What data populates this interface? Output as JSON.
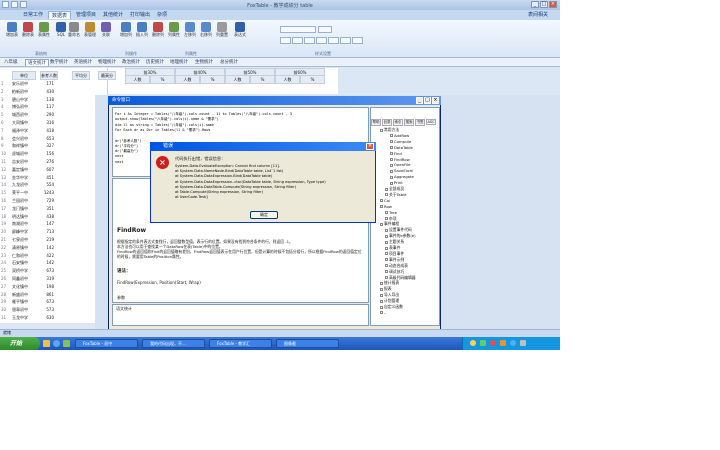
{
  "app": {
    "title": "FoxTable - 教学成绩分 table"
  },
  "menus": [
    "日常工作",
    "数据表",
    "管理项目",
    "其他统计",
    "打印输出",
    "杂项"
  ],
  "menu_right": "表间相关",
  "ribbon": {
    "buttons": [
      {
        "label": "增加表",
        "color": "#4b7fc4"
      },
      {
        "label": "删除表",
        "color": "#c04848"
      },
      {
        "label": "表属性",
        "color": "#6a9a4a"
      },
      {
        "label": "SQL",
        "color": "#3060a8"
      },
      {
        "label": "重命名",
        "color": "#8a8a8a"
      },
      {
        "label": "表管理",
        "color": "#c08a30"
      },
      {
        "label": "关联",
        "color": "#7060b0"
      },
      {
        "label": "增加列",
        "color": "#4b7fc4"
      },
      {
        "label": "插入列",
        "color": "#4b7fc4"
      },
      {
        "label": "删除列",
        "color": "#c04848"
      },
      {
        "label": "列属性",
        "color": "#6a9a4a"
      },
      {
        "label": "左移列",
        "color": "#5a8acb"
      },
      {
        "label": "右移列",
        "color": "#5a8acb"
      },
      {
        "label": "列重置",
        "color": "#9a9a9a"
      },
      {
        "label": "表达式",
        "color": "#3060a8"
      }
    ],
    "groups": [
      "表结构",
      "列操作",
      "列属性",
      "样式设置"
    ]
  },
  "tabs": [
    "八年级",
    "语文统计",
    "数学统计",
    "英语统计",
    "物理统计",
    "政治统计",
    "历史统计",
    "地理统计",
    "生物统计",
    "总分统计"
  ],
  "active_tab": "语文统计",
  "grid": {
    "headers": [
      "单位",
      "参考人数",
      "平均分",
      "最高分",
      "前30%",
      "前40%",
      "前50%",
      "前60%"
    ],
    "subheaders": [
      "人数",
      "%",
      "人数",
      "%",
      "人数",
      "%",
      "人数",
      "%"
    ],
    "rows": [
      [
        "安乐初中",
        "171"
      ],
      [
        "柏新初中",
        "430"
      ],
      [
        "碧山中学",
        "138"
      ],
      [
        "博弘初中",
        "117"
      ],
      [
        "城西初中",
        "290"
      ],
      [
        "大同镇中",
        "316"
      ],
      [
        "福泽中学",
        "418"
      ],
      [
        "会兴初中",
        "653"
      ],
      [
        "和祥镇中",
        "327"
      ],
      [
        "虎城初中",
        "156"
      ],
      [
        "吉安初中",
        "276"
      ],
      [
        "嘉定镇中",
        "607"
      ],
      [
        "金华中学",
        "451"
      ],
      [
        "九龙初中",
        "554"
      ],
      [
        "莱平一中",
        "1243"
      ],
      [
        "兰园初中",
        "729"
      ],
      [
        "龙门镇中",
        "351"
      ],
      [
        "明达镇中",
        "438"
      ],
      [
        "南湖初中",
        "147"
      ],
      [
        "屏峰中学",
        "713"
      ],
      [
        "七泉初中",
        "219"
      ],
      [
        "清原镇中",
        "142"
      ],
      [
        "仁和初中",
        "422"
      ],
      [
        "石安镇中",
        "142"
      ],
      [
        "双桥中学",
        "673"
      ],
      [
        "同鑫初中",
        "319"
      ],
      [
        "文化镇中",
        "198"
      ],
      [
        "新盛初中",
        "861"
      ],
      [
        "雁平镇中",
        "673"
      ],
      [
        "银翠初中",
        "573"
      ],
      [
        "玉龙中学",
        "630"
      ]
    ]
  },
  "command_window": {
    "title": "命令窗口",
    "code_lines": [
      "For i As Integer = Tables(\"八年级\").cols.count - 11 to Tables(\"八年级\").cols.count - 3",
      "output.show(Tables(\"八年级\").cols(i).name & \"需求\")",
      "dim ll as string = Tables(\"八年级\").cols(i).name",
      "For Each dr as Dcr in Tables(ll & \"需求\").Rows",
      "",
      "dr(\"参考人数\")",
      "dr(\"平均分\")",
      "dr(\"最高分\")",
      "next",
      "next"
    ],
    "help": {
      "heading": "FindRow",
      "paragraph1": "根据指定的条件表达式查找行，返回整数型值，表示行的位置。如果没有找到符合条件的行，则返回 -1。",
      "paragraph2": "本方法也可以用于查找某一个DataRow在表(Table)中的位置。",
      "paragraph3": "FindRow的返回值和Find的返回值略有差别，FindRow返回值表示在用户行位置，但是计算的时候不包括分组行，所以根据FindRow的返回值定位的时候，需要用Table的Position属性。",
      "syntax_label": "语法：",
      "syntax": "FindRow(Expression, Position(Start, Wrap)",
      "param_label": "参数",
      "footer_label": "语文统计"
    },
    "buttons": [
      "查找替换",
      "执行",
      "取消"
    ]
  },
  "tree": {
    "tabs": [
      "帮助",
      "目录",
      "索引",
      "搜索",
      "书签",
      "ASC"
    ],
    "nodes": [
      {
        "label": "常用方法",
        "indent": 0
      },
      {
        "label": "AddRow",
        "indent": 2
      },
      {
        "label": "Compute",
        "indent": 2
      },
      {
        "label": "DataTable",
        "indent": 2
      },
      {
        "label": "Find",
        "indent": 2
      },
      {
        "label": "FindRow",
        "indent": 2
      },
      {
        "label": "OpenFile",
        "indent": 2
      },
      {
        "label": "SaveExcel",
        "indent": 2
      },
      {
        "label": "Aggregate",
        "indent": 2
      },
      {
        "label": "Print",
        "indent": 2
      },
      {
        "label": "全部成员",
        "indent": 1
      },
      {
        "label": "关于Table",
        "indent": 1
      },
      {
        "label": "Col",
        "indent": 0
      },
      {
        "label": "Row",
        "indent": 0
      },
      {
        "label": "Tree",
        "indent": 1
      },
      {
        "label": "杂项",
        "indent": 1
      },
      {
        "label": "事件编程",
        "indent": 0
      },
      {
        "label": "设置事件代码",
        "indent": 1
      },
      {
        "label": "事件的e参数(e)",
        "indent": 1
      },
      {
        "label": "主题关系",
        "indent": 1
      },
      {
        "label": "表事件",
        "indent": 1
      },
      {
        "label": "项目事件",
        "indent": 1
      },
      {
        "label": "事件示例",
        "indent": 1
      },
      {
        "label": "动态合成表",
        "indent": 1
      },
      {
        "label": "调试技巧",
        "indent": 1
      },
      {
        "label": "高级代码编辑器",
        "indent": 1
      },
      {
        "label": "统计报表",
        "indent": 0
      },
      {
        "label": "报表",
        "indent": 0
      },
      {
        "label": "导入导出",
        "indent": 0
      },
      {
        "label": "计划管理",
        "indent": 0
      },
      {
        "label": "自定义函数",
        "indent": 0
      },
      {
        "label": "..",
        "indent": 0
      }
    ]
  },
  "error_dialog": {
    "title": "错误",
    "message_title": "代码执行出错，错误信息：",
    "lines": [
      "System.Data.EvaluateException: Cannot find column [11].",
      "   at System.Data.NameNode.Bind(DataTable table, List`1 list)",
      "   at System.Data.DataExpression.Bind(DataTable table)",
      "   at System.Data.DataExpression..ctor(DataTable table, String expression, Type type)",
      "   at System.Data.DataTable.Compute(String expression, String filter)",
      "   at Table.Compute(String expression, String filter)",
      "   at UserCode.Test()"
    ],
    "ok": "确定"
  },
  "status_text": "就绪",
  "taskbar": {
    "start": "开始",
    "items": [
      "FoxTable - 初中",
      "我的代码出现，不...",
      "FoxTable - 教学汇",
      "图像截",
      ""
    ],
    "clock": ""
  }
}
